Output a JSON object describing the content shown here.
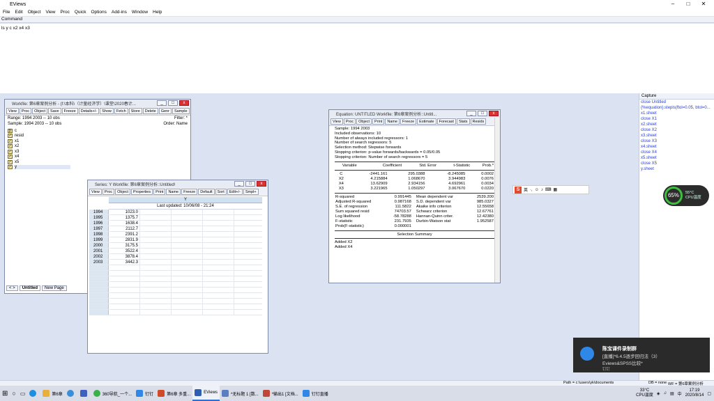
{
  "app": {
    "title": "EViews",
    "controls": [
      "–",
      "□",
      "✕"
    ]
  },
  "menu": [
    "File",
    "Edit",
    "Object",
    "View",
    "Proc",
    "Quick",
    "Options",
    "Add-ins",
    "Window",
    "Help"
  ],
  "command": {
    "label": "Command",
    "text": "ls y c x2 x4 x3"
  },
  "workfile": {
    "title": "Workfile: 第6章案例分析 - (f:\\本料\\（计量经济学）\\课堂\\2020春计...",
    "toolbar": [
      "View",
      "Proc",
      "Object",
      "Save",
      "Freeze",
      "Details+/-",
      "Show",
      "Fetch",
      "Store",
      "Delete",
      "Genr",
      "Sample"
    ],
    "range": "Range: 1994 2003  --  10 obs",
    "sample": "Sample: 1994 2003  --  10 obs",
    "filter": "Filter: *",
    "order": "Order: Name",
    "objects": [
      "c",
      "resid",
      "x1",
      "x2",
      "x3",
      "x4",
      "x5",
      "y"
    ],
    "tabs": [
      "Untitled",
      "New Page"
    ],
    "nav": "< >"
  },
  "series": {
    "title": "Series: Y   Workfile: 第6章案例分析::Untitled\\",
    "toolbar": [
      "View",
      "Proc",
      "Object",
      "Properties",
      "Print",
      "Name",
      "Freeze",
      "Default",
      "Sort",
      "Edit+/-",
      "Smpl+"
    ],
    "col_header": "Y",
    "updated": "Last updated: 10/06/08 - 21:24",
    "years": [
      "1994",
      "1995",
      "1996",
      "1997",
      "1998",
      "1999",
      "2000",
      "2001",
      "2002",
      "2003"
    ],
    "values": [
      "1023.0",
      "1375.7",
      "1638.4",
      "2112.7",
      "2391.2",
      "2831.9",
      "3175.5",
      "3522.4",
      "3878.4",
      "3442.3"
    ]
  },
  "equation": {
    "title": "Equation: UNTITLED   Workfile: 第6章案例分析::Untitl...",
    "toolbar": [
      "View",
      "Proc",
      "Object",
      "Print",
      "Name",
      "Freeze",
      "Estimate",
      "Forecast",
      "Stats",
      "Resids"
    ],
    "header_lines": [
      "Sample: 1994 2003",
      "Included observations: 10",
      "Number of always included regressors: 1",
      "Number of search regressors: 5",
      "Selection method: Stepwise forwards",
      "Stopping criterion: p-value forwards/backwards = 0.05/0.05",
      "Stopping criterion: Number of search regressors = 5"
    ],
    "coef_header": [
      "Variable",
      "Coefficient",
      "Std. Error",
      "t-Statistic",
      "Prob.*"
    ],
    "coef_rows": [
      [
        "C",
        "-2441.161",
        "295.0388",
        "-8.245085",
        "0.0002"
      ],
      [
        "X2",
        "4.215884",
        "1.068670",
        "3.944983",
        "0.0076"
      ],
      [
        "X4",
        "13.62909",
        "2.934156",
        "4.692961",
        "0.0034"
      ],
      [
        "X3",
        "3.221965",
        "1.050297",
        "3.067670",
        "0.0220"
      ]
    ],
    "stats_rows": [
      [
        "R-squared",
        "0.991445",
        "Mean dependent var",
        "2539.200"
      ],
      [
        "Adjusted R-squared",
        "0.987168",
        "S.D. dependent var",
        "985.0327"
      ],
      [
        "S.E. of regression",
        "111.5822",
        "Akaike info criterion",
        "12.55658"
      ],
      [
        "Sum squared resid",
        "74703.57",
        "Schwarz criterion",
        "12.67761"
      ],
      [
        "Log likelihood",
        "-58.78288",
        "Hannan-Quinn criter.",
        "12.42380"
      ],
      [
        "F-statistic",
        "231.7935",
        "Durbin-Watson stat",
        "1.952587"
      ],
      [
        "Prob(F-statistic)",
        "0.000001",
        "",
        ""
      ]
    ],
    "summary_title": "Selection Summary",
    "summary_lines": [
      "Added X2",
      "Added X4"
    ]
  },
  "capture": {
    "label": "Capture",
    "lines": [
      "close Untitled",
      "{%equation}.stepls(ftol=0.05, btol=0...",
      "x1.sheet",
      "close X1",
      "x2.sheet",
      "close X2",
      "x3.sheet",
      "close X3",
      "x4.sheet",
      "close X4",
      "x5.sheet",
      "close X5",
      "y.sheet"
    ]
  },
  "ime": {
    "logo": "S",
    "mode": "英"
  },
  "cpu": {
    "percent": "65%",
    "temp": "55°C",
    "label": "CPU温度"
  },
  "toast": {
    "title": "陈宝课件录制群",
    "line1": "[直播]*6.4.5逐步回归法（3）",
    "line2": "Eviews&SPSS比较*",
    "source": "钉钉"
  },
  "status": {
    "path": "Path = c:\\users\\yk\\documents",
    "db": "DB = none",
    "wf": "WF = 第6章案例分析"
  },
  "taskbar": {
    "items": [
      "第6章",
      "360导航_一个...",
      "钉钉",
      "第6章 多重...",
      "EViews",
      "*无标题 1 [数...",
      "*输出1 [文档...",
      "钉钉直播"
    ],
    "weather_temp": "33°C",
    "weather_label": "CPU温度",
    "ime": "中",
    "time": "17:19",
    "date": "2020/8/14"
  }
}
